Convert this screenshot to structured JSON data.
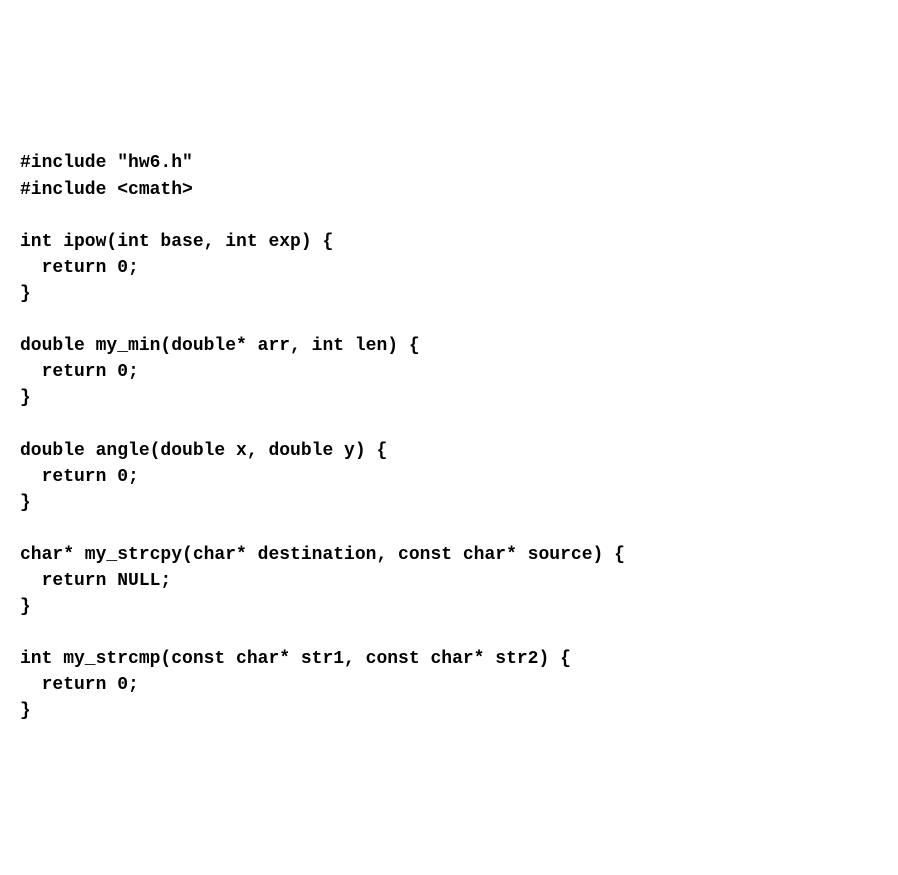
{
  "code": {
    "line01": "#include \"hw6.h\"",
    "line02": "#include <cmath>",
    "line03": "",
    "line04": "int ipow(int base, int exp) {",
    "line05": "  return 0;",
    "line06": "}",
    "line07": "",
    "line08": "double my_min(double* arr, int len) {",
    "line09": "  return 0;",
    "line10": "}",
    "line11": "",
    "line12": "double angle(double x, double y) {",
    "line13": "  return 0;",
    "line14": "}",
    "line15": "",
    "line16": "char* my_strcpy(char* destination, const char* source) {",
    "line17": "  return NULL;",
    "line18": "}",
    "line19": "",
    "line20": "int my_strcmp(const char* str1, const char* str2) {",
    "line21": "  return 0;",
    "line22": "}"
  }
}
